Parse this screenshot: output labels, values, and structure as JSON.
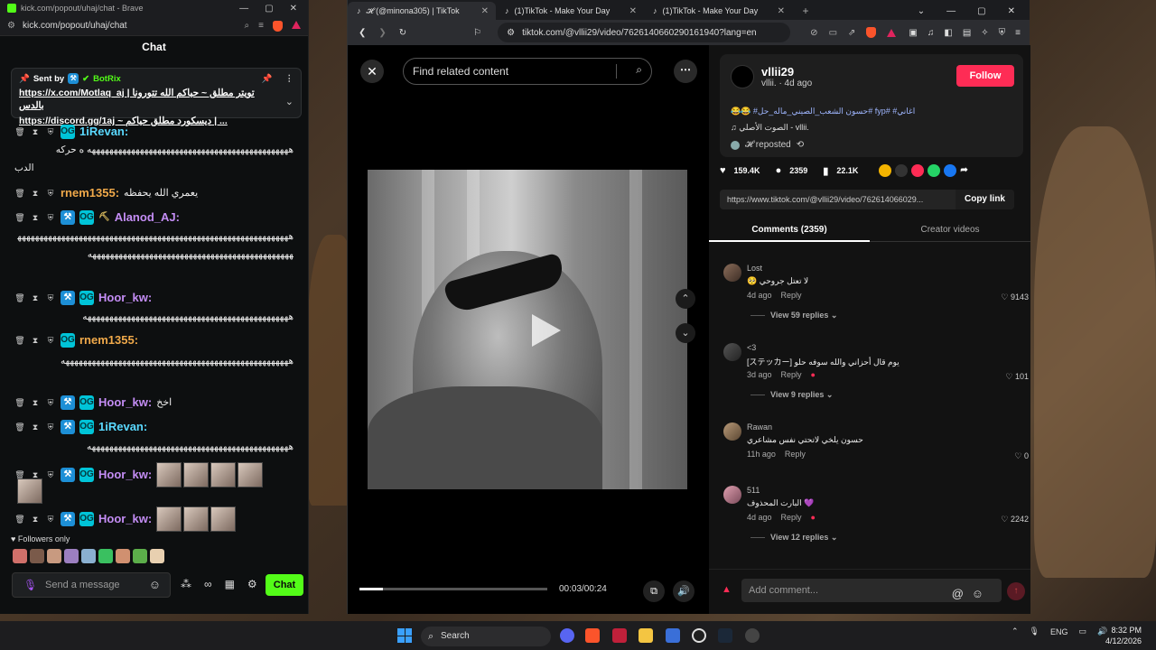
{
  "kick": {
    "title": "kick.com/popout/uhaj/chat - Brave",
    "url": "kick.com/popout/uhaj/chat",
    "chat_header": "Chat",
    "pinned": {
      "sent_by": "Sent by",
      "bot": "BotRix",
      "line1": "https://x.com/Motlaq_aj | تويتر مطلق ~ حياكم الله تتورونا بالدس",
      "line2": "https://discord.gg/1aj ~ ديسكورد مطلق حياكم | ..."
    },
    "messages": [
      {
        "user": "1iRevan:",
        "text": "ه حركه"
      },
      {
        "user": "",
        "text": "الدب"
      },
      {
        "user": "rnem1355:",
        "text": "يعمري الله يحفظه"
      },
      {
        "user": "Alanod_AJ:",
        "text": ""
      },
      {
        "user": "Hoor_kw:",
        "text": ""
      },
      {
        "user": "rnem1355:",
        "text": ""
      },
      {
        "user": "Hoor_kw:",
        "text": "اخخ"
      },
      {
        "user": "1iRevan:",
        "text": ""
      },
      {
        "user": "Hoor_kw:",
        "text": ""
      },
      {
        "user": "Hoor_kw:",
        "text": ""
      }
    ],
    "spam1": "ههههههههههههههههههههههههههههههههههههههههههههههه",
    "spam2": "هههههههههههههههههههههههههههههههههههههههههههههههههههههههههههههههههههههههههههههههههههههههههههههههههههههههههههههه",
    "spam3": "هههههههههههههههههههههههههههههههههههههههههههههههه",
    "spam4": "ههههههههههههههههههههههههههههههههههههههههههههههههههههه",
    "spam5": "ههههههههههههههههههههههههههههههههههههههههههههههه",
    "followers_only": "Followers only",
    "send_placeholder": "Send a message",
    "chat_button": "Chat",
    "infinity": "∞"
  },
  "browser": {
    "tabs": [
      {
        "label": "𝓗 (@minona305) | TikTok"
      },
      {
        "label": "(1)TikTok - Make Your Day"
      },
      {
        "label": "(1)TikTok - Make Your Day"
      }
    ],
    "url": "tiktok.com/@vllii29/video/7626140660290161940?lang=en"
  },
  "video": {
    "find_placeholder": "Find related content",
    "time": "00:03/00:24",
    "progress": 0.125
  },
  "post": {
    "username": "vllii29",
    "meta": "vllii. · 4d ago",
    "follow": "Follow",
    "tags": "اغاني# #fyp #حسون الشعب_الصيني_ماله_حل# 😂😂",
    "sound": "الصوت الأصلي - vllii.",
    "reposted": "𝓗 reposted",
    "likes": "159.4K",
    "comments": "2359",
    "saves": "22.1K",
    "link": "https://www.tiktok.com/@vllii29/video/762614066029...",
    "copy": "Copy link",
    "tab_comments": "Comments (2359)",
    "tab_creator": "Creator videos"
  },
  "comments": [
    {
      "name": "Lost",
      "text": "لا تعتل جروحي 🥺",
      "date": "4d ago",
      "reply": "Reply",
      "likes": "9143",
      "replies": "View 59 replies"
    },
    {
      "name": "<3",
      "text": "يوم قال أحزاني والله سوفه حلو [ステッカー]",
      "date": "3d ago",
      "reply": "Reply",
      "likes": "101",
      "replies": "View 9 replies"
    },
    {
      "name": "Rawan",
      "text": "حسون يلخي لاتحتي نفس مشاعري",
      "date": "11h ago",
      "reply": "Reply",
      "likes": "0",
      "replies": ""
    },
    {
      "name": "511",
      "text": "💜 البارت المحذوف",
      "date": "4d ago",
      "reply": "Reply",
      "likes": "2242",
      "replies": "View 12 replies"
    }
  ],
  "add_comment": "Add comment...",
  "taskbar": {
    "search": "Search",
    "lang": "ENG",
    "time": "8:32 PM",
    "date": "4/12/2026"
  }
}
